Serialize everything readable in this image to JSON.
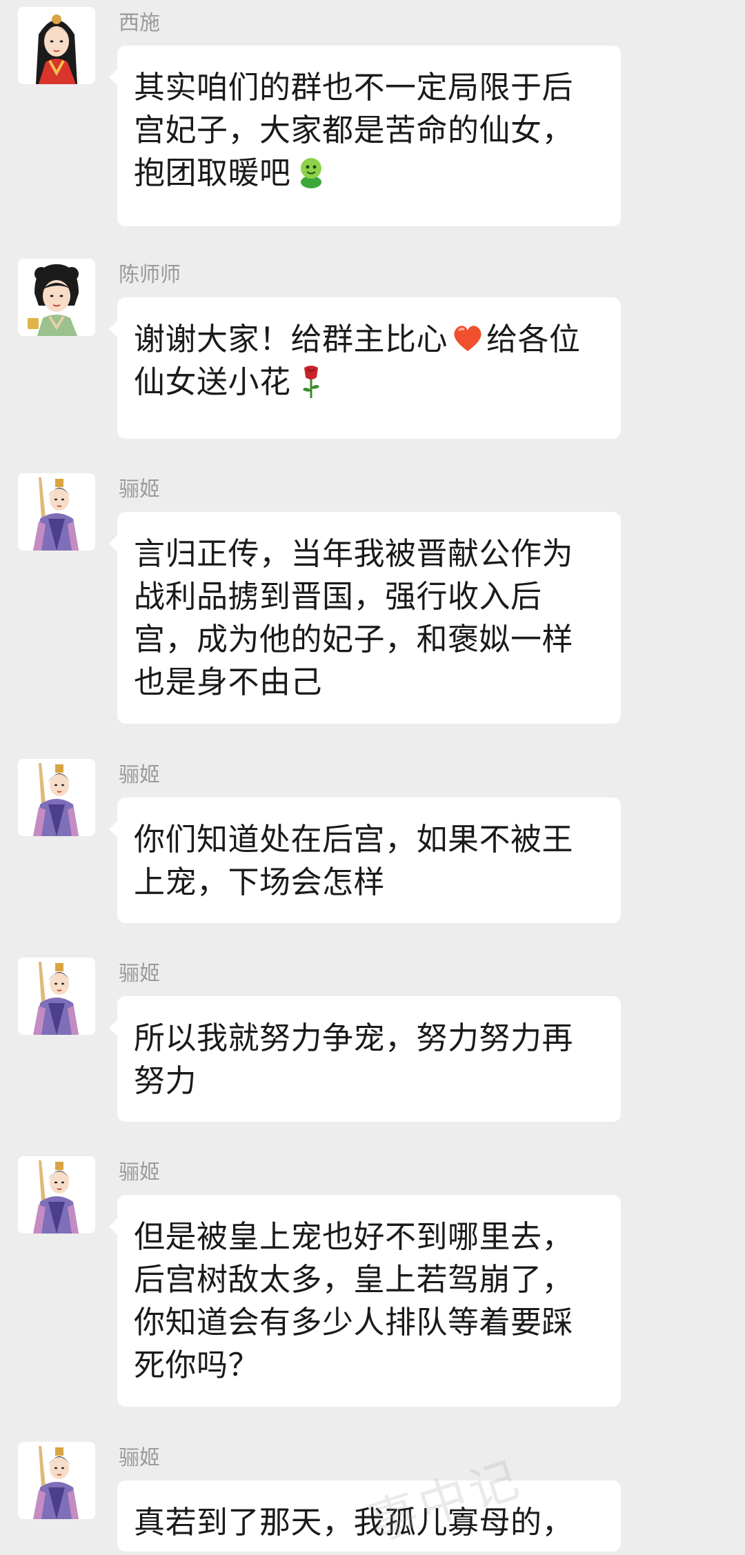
{
  "messages": [
    {
      "sender": "西施",
      "avatar_icon": "xishi-avatar-icon",
      "text": "其实咱们的群也不一定局限于后宫妃子，大家都是苦命的仙女，抱团取暖吧",
      "emoji": "smiley-face-emoji"
    },
    {
      "sender": "陈师师",
      "avatar_icon": "chenshishi-avatar-icon",
      "text_parts": [
        "谢谢大家！给群主比心",
        "给各位仙女送小花"
      ],
      "emojis": [
        "heart-emoji",
        "rose-emoji"
      ]
    },
    {
      "sender": "骊姬",
      "avatar_icon": "liji-avatar-icon",
      "text": "言归正传，当年我被晋献公作为战利品掳到晋国，强行收入后宫，成为他的妃子，和褒姒一样也是身不由己"
    },
    {
      "sender": "骊姬",
      "avatar_icon": "liji-avatar-icon",
      "text": "你们知道处在后宫，如果不被王上宠，下场会怎样"
    },
    {
      "sender": "骊姬",
      "avatar_icon": "liji-avatar-icon",
      "text": "所以我就努力争宠，努力努力再努力"
    },
    {
      "sender": "骊姬",
      "avatar_icon": "liji-avatar-icon",
      "text": "但是被皇上宠也好不到哪里去，后宫树敌太多，皇上若驾崩了，你知道会有多少人排队等着要踩死你吗？"
    },
    {
      "sender": "骊姬",
      "avatar_icon": "liji-avatar-icon",
      "text": "真若到了那天，我孤儿寡母的，"
    }
  ],
  "watermark": "事中记",
  "colors": {
    "background": "#ededed",
    "bubble": "#ffffff",
    "sender": "#9a9a9a",
    "text": "#1a1a1a"
  }
}
